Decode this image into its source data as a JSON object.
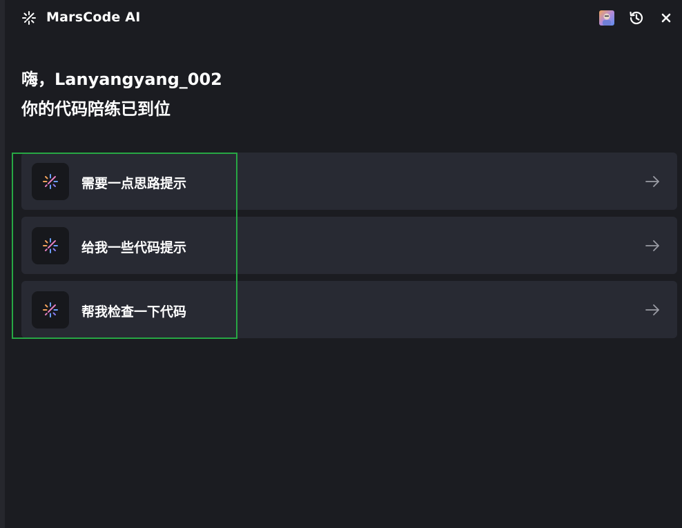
{
  "header": {
    "title": "MarsCode AI",
    "brand_icon": "sparkle-icon",
    "avatar_icon": "user-avatar",
    "history_icon": "history-icon",
    "close_icon": "close-icon"
  },
  "greeting": {
    "line1": "嗨，Lanyangyang_002",
    "line2": "你的代码陪练已到位"
  },
  "options": [
    {
      "label": "需要一点思路提示",
      "icon": "sparkle-icon",
      "arrow": "arrow-right-icon"
    },
    {
      "label": "给我一些代码提示",
      "icon": "sparkle-icon",
      "arrow": "arrow-right-icon"
    },
    {
      "label": "帮我检查一下代码",
      "icon": "sparkle-icon",
      "arrow": "arrow-right-icon"
    }
  ],
  "colors": {
    "background": "#1b1c21",
    "card": "#282a33",
    "icon_box": "#17181c",
    "highlight": "#27a844",
    "text": "#ffffff",
    "arrow": "#9a9ca5"
  }
}
